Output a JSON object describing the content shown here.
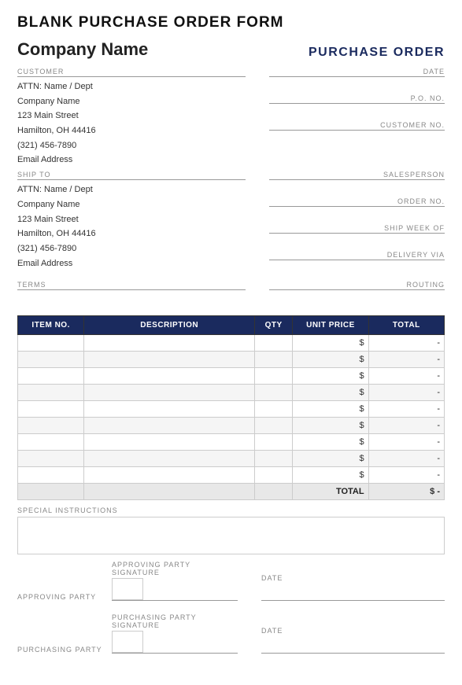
{
  "page": {
    "title": "BLANK PURCHASE ORDER FORM",
    "company_name": "Company Name",
    "purchase_order_label": "PURCHASE ORDER"
  },
  "customer": {
    "section_label": "CUSTOMER",
    "attn": "ATTN: Name / Dept",
    "company": "Company Name",
    "address": "123 Main Street",
    "city": "Hamilton, OH  44416",
    "phone": "(321) 456-7890",
    "email": "Email Address"
  },
  "ship_to": {
    "section_label": "SHIP TO",
    "attn": "ATTN: Name / Dept",
    "company": "Company Name",
    "address": "123 Main Street",
    "city": "Hamilton, OH  44416",
    "phone": "(321) 456-7890",
    "email": "Email Address"
  },
  "right_fields_top": [
    {
      "label": "DATE",
      "value": ""
    },
    {
      "label": "P.O. NO.",
      "value": ""
    },
    {
      "label": "CUSTOMER NO.",
      "value": ""
    }
  ],
  "right_fields_mid": [
    {
      "label": "SALESPERSON",
      "value": ""
    },
    {
      "label": "ORDER NO.",
      "value": ""
    },
    {
      "label": "SHIP WEEK OF",
      "value": ""
    },
    {
      "label": "DELIVERY VIA",
      "value": ""
    }
  ],
  "terms": {
    "label": "TERMS",
    "value": ""
  },
  "routing": {
    "label": "ROUTING",
    "value": ""
  },
  "table": {
    "headers": [
      "ITEM NO.",
      "DESCRIPTION",
      "QTY",
      "UNIT PRICE",
      "TOTAL"
    ],
    "rows": [
      {
        "item": "",
        "desc": "",
        "qty": "",
        "unit": "$",
        "total": "-"
      },
      {
        "item": "",
        "desc": "",
        "qty": "",
        "unit": "$",
        "total": "-"
      },
      {
        "item": "",
        "desc": "",
        "qty": "",
        "unit": "$",
        "total": "-"
      },
      {
        "item": "",
        "desc": "",
        "qty": "",
        "unit": "$",
        "total": "-"
      },
      {
        "item": "",
        "desc": "",
        "qty": "",
        "unit": "$",
        "total": "-"
      },
      {
        "item": "",
        "desc": "",
        "qty": "",
        "unit": "$",
        "total": "-"
      },
      {
        "item": "",
        "desc": "",
        "qty": "",
        "unit": "$",
        "total": "-"
      },
      {
        "item": "",
        "desc": "",
        "qty": "",
        "unit": "$",
        "total": "-"
      },
      {
        "item": "",
        "desc": "",
        "qty": "",
        "unit": "$",
        "total": "-"
      }
    ],
    "total_label": "TOTAL",
    "total_dollar": "$",
    "total_value": "-"
  },
  "special_instructions": {
    "label": "SPECIAL INSTRUCTIONS"
  },
  "signatures": [
    {
      "party_label": "APPROVING PARTY",
      "sig_label": "APPROVING PARTY SIGNATURE",
      "date_label": "DATE"
    },
    {
      "party_label": "PURCHASING PARTY",
      "sig_label": "PURCHASING PARTY SIGNATURE",
      "date_label": "DATE"
    }
  ]
}
